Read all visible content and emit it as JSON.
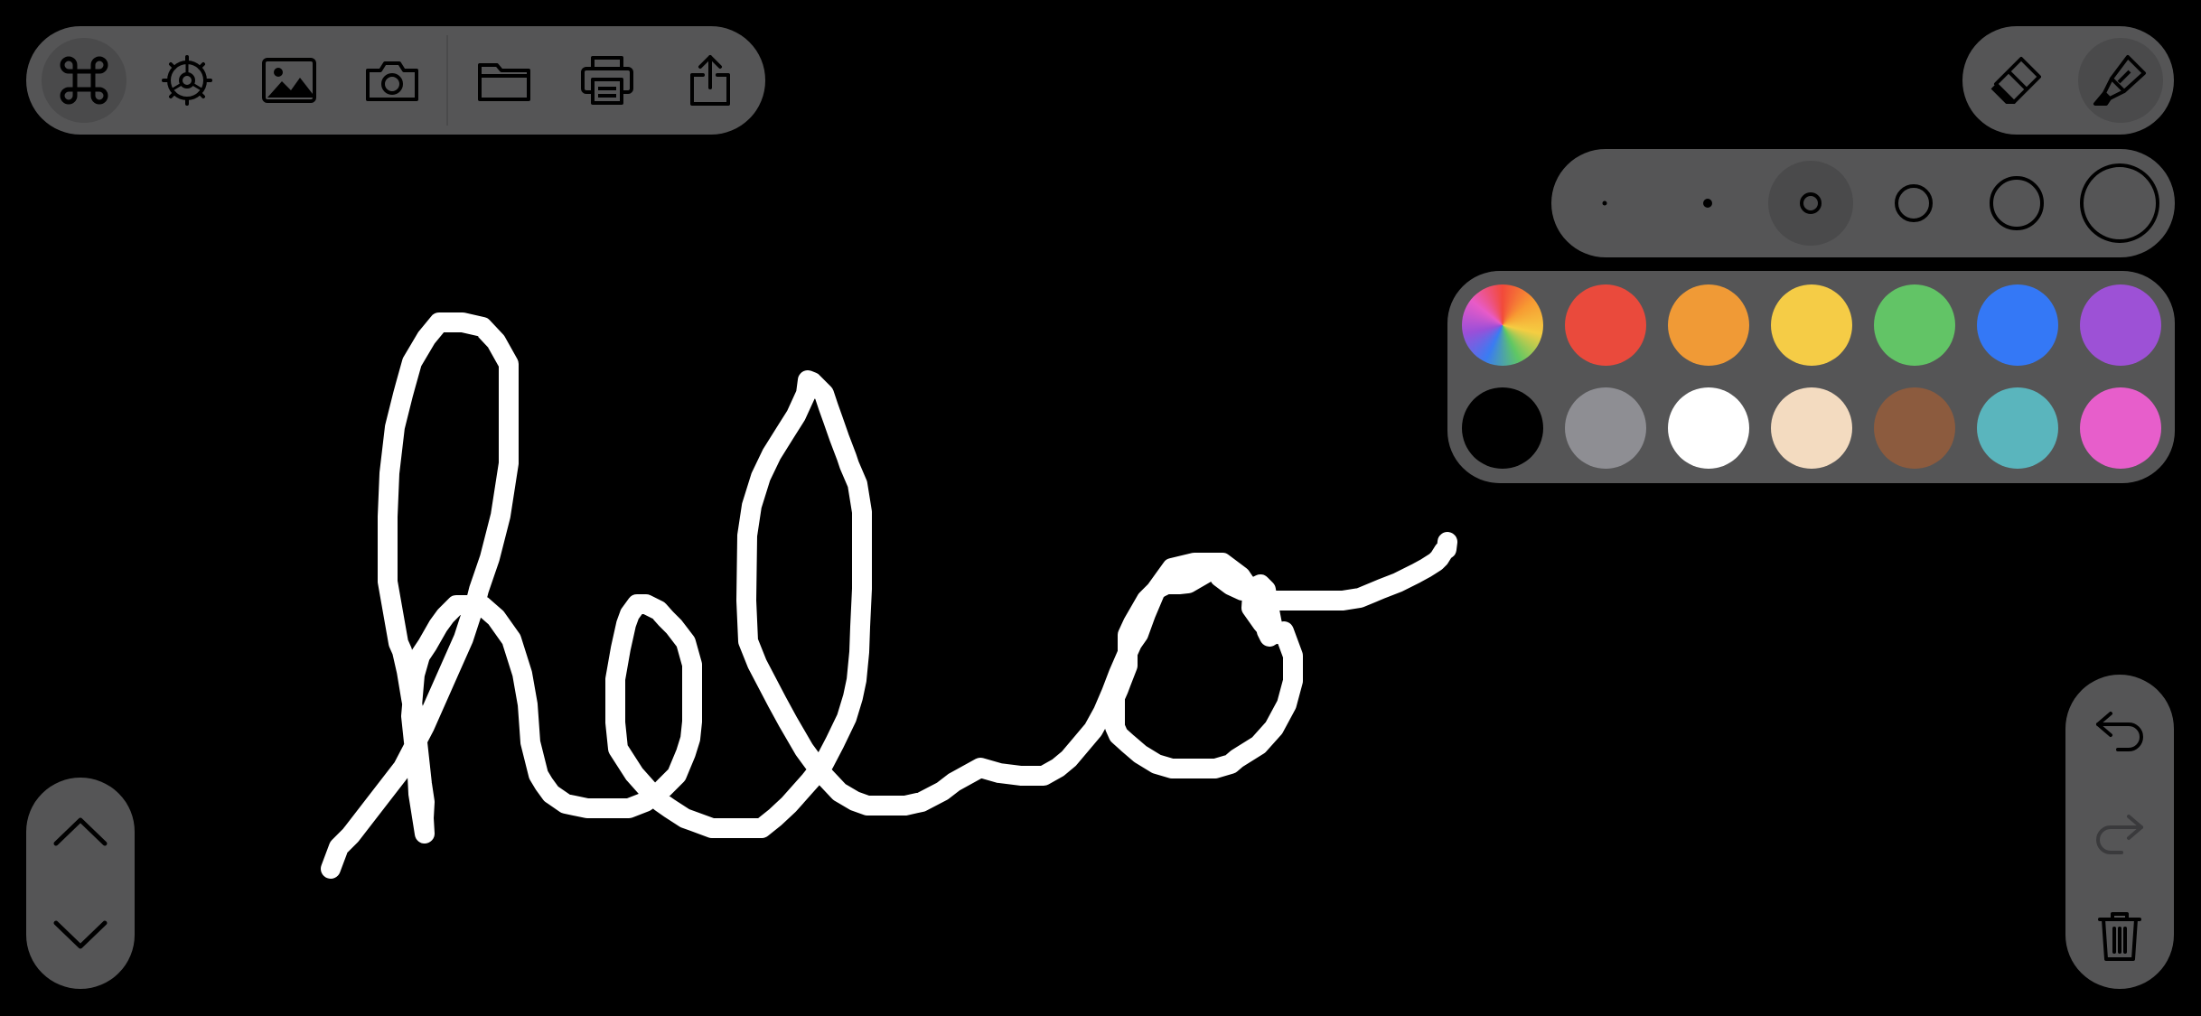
{
  "toolbar": {
    "icons": [
      "command-icon",
      "settings-gear-icon",
      "image-icon",
      "camera-icon",
      "folder-icon",
      "printer-icon",
      "share-icon"
    ]
  },
  "tools": {
    "items": [
      "eraser-icon",
      "highlighter-icon"
    ],
    "selected": "highlighter"
  },
  "brush_sizes": {
    "count": 6,
    "selected_index": 2
  },
  "palette": {
    "colors": [
      "#ea4a3c",
      "#f09a36",
      "#f5cc46",
      "#62c466",
      "#3478f6",
      "#9d51d6",
      "#000000",
      "#8e8e93",
      "#ffffff",
      "#f3dbc0",
      "#8c5b3e",
      "#5ab5bd",
      "#e75ecb"
    ],
    "first_swatch": "rainbow-spectrum",
    "selected_color": "#ffffff"
  },
  "history": {
    "icons": [
      "undo-icon",
      "redo-icon",
      "trash-icon"
    ],
    "redo_enabled": false
  },
  "pager": {
    "icons": [
      "chevron-up-icon",
      "chevron-down-icon"
    ]
  },
  "canvas": {
    "background": "#000000",
    "stroke_color": "#ffffff",
    "handwritten_text": "hello"
  }
}
